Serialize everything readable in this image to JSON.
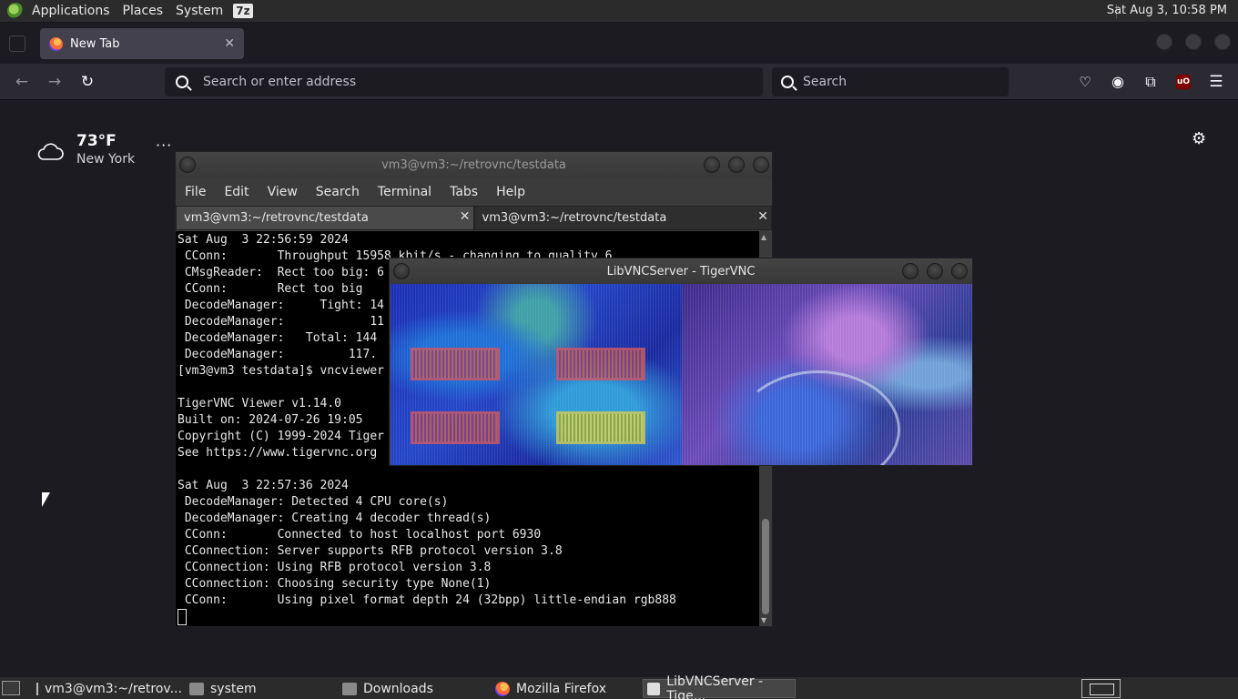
{
  "top_panel": {
    "menus": [
      "Applications",
      "Places",
      "System"
    ],
    "app_7z": "7z",
    "clock": "Sat Aug  3, 10:58 PM"
  },
  "firefox": {
    "tab_title": "New Tab",
    "tab_close": "✕",
    "url_placeholder": "Search or enter address",
    "search_placeholder": "Search",
    "ublock_label": "uO",
    "weather": {
      "temp": "73°F",
      "city": "New York",
      "more": "···"
    }
  },
  "terminal": {
    "title": "vm3@vm3:~/retrovnc/testdata",
    "menu": [
      "File",
      "Edit",
      "View",
      "Search",
      "Terminal",
      "Tabs",
      "Help"
    ],
    "tabs": [
      "vm3@vm3:~/retrovnc/testdata",
      "vm3@vm3:~/retrovnc/testdata"
    ],
    "tab_close": "✕",
    "lines": [
      "Sat Aug  3 22:56:59 2024",
      " CConn:       Throughput 15958 kbit/s - changing to quality 6",
      " CMsgReader:  Rect too big: 6",
      " CConn:       Rect too big",
      " DecodeManager:     Tight: 14",
      " DecodeManager:            11",
      " DecodeManager:   Total: 144",
      " DecodeManager:         117.",
      "[vm3@vm3 testdata]$ vncviewer",
      "",
      "TigerVNC Viewer v1.14.0",
      "Built on: 2024-07-26 19:05",
      "Copyright (C) 1999-2024 Tiger",
      "See https://www.tigervnc.org",
      "",
      "Sat Aug  3 22:57:36 2024",
      " DecodeManager: Detected 4 CPU core(s)",
      " DecodeManager: Creating 4 decoder thread(s)",
      " CConn:       Connected to host localhost port 6930",
      " CConnection: Server supports RFB protocol version 3.8",
      " CConnection: Using RFB protocol version 3.8",
      " CConnection: Choosing security type None(1)",
      " CConn:       Using pixel format depth 24 (32bpp) little-endian rgb888"
    ]
  },
  "vnc": {
    "title": "LibVNCServer - TigerVNC"
  },
  "taskbar": {
    "items": [
      "vm3@vm3:~/retrov...",
      "system",
      "Downloads",
      "Mozilla Firefox",
      "LibVNCServer - Tige..."
    ]
  }
}
